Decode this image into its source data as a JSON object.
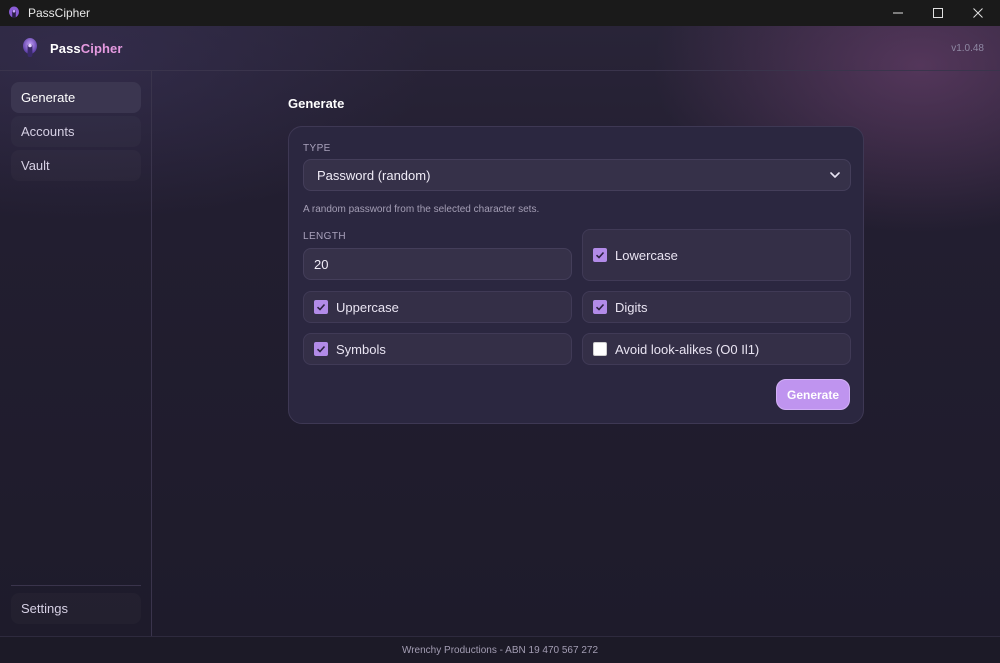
{
  "window": {
    "title": "PassCipher"
  },
  "header": {
    "brand_part1": "Pass",
    "brand_part2": "Cipher",
    "version": "v1.0.48"
  },
  "sidebar": {
    "items": [
      {
        "label": "Generate",
        "active": true
      },
      {
        "label": "Accounts",
        "active": false
      },
      {
        "label": "Vault",
        "active": false
      }
    ],
    "settings_label": "Settings"
  },
  "main": {
    "title": "Generate",
    "type_label": "TYPE",
    "type_value": "Password (random)",
    "type_hint": "A random password from the selected character sets.",
    "length_label": "LENGTH",
    "length_value": "20",
    "options": [
      {
        "label": "Lowercase",
        "checked": true
      },
      {
        "label": "Uppercase",
        "checked": true
      },
      {
        "label": "Digits",
        "checked": true
      },
      {
        "label": "Symbols",
        "checked": true
      },
      {
        "label": "Avoid look-alikes (O0 Il1)",
        "checked": false
      }
    ],
    "generate_label": "Generate"
  },
  "footer": {
    "text": "Wrenchy Productions - ABN 19 470 567 272"
  },
  "colors": {
    "accent": "#bf94ef",
    "brand_accent": "#e59ae0",
    "checkbox": "#b28be8",
    "background": "#1e1b2b"
  },
  "icons": {
    "app": "lock-keyhole-icon",
    "dropdown": "chevron-down-icon",
    "checkbox": "check-icon"
  }
}
